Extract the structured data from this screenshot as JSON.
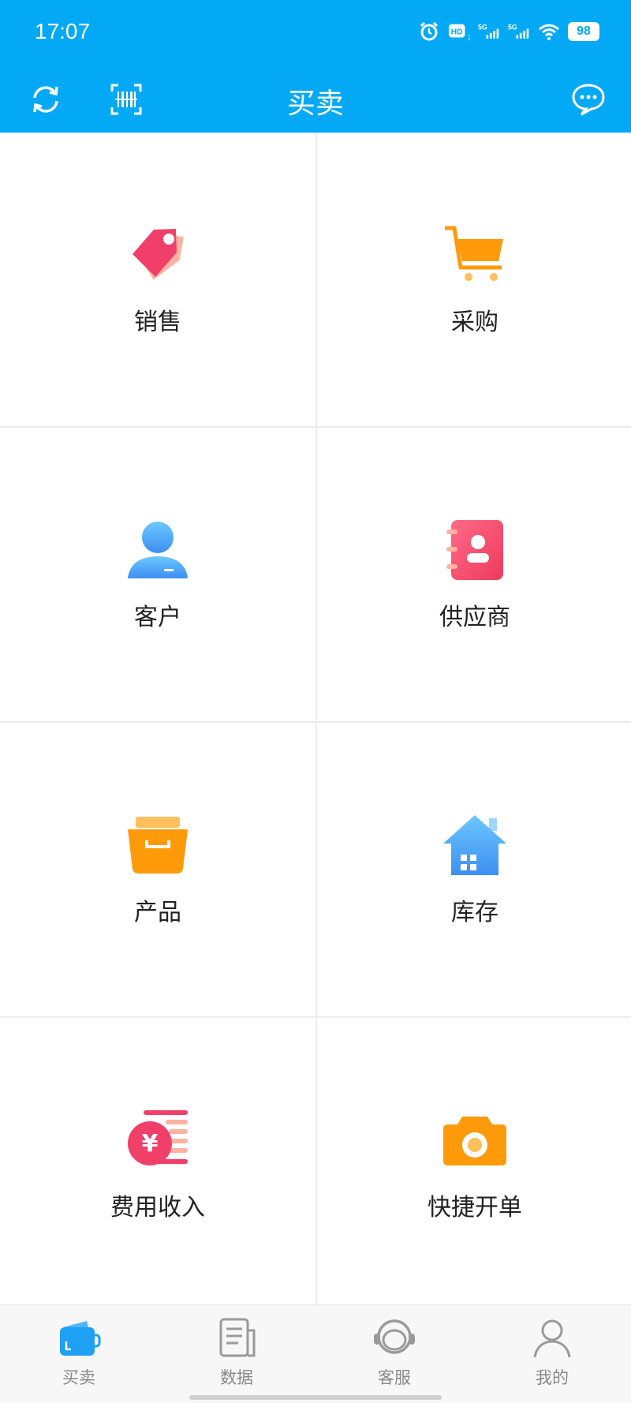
{
  "status_bar": {
    "time": "17:07",
    "battery": "98",
    "icons": [
      "alarm-icon",
      "hd-icon",
      "signal-5g-icon",
      "signal-5g-icon",
      "wifi-icon",
      "battery-icon"
    ]
  },
  "app_bar": {
    "title": "买卖",
    "left_icons": [
      "refresh-icon",
      "barcode-scan-icon"
    ],
    "right_icon": "message-icon"
  },
  "tiles": [
    {
      "label": "销售",
      "icon": "price-tag-icon",
      "color": "#f0406a"
    },
    {
      "label": "采购",
      "icon": "shopping-cart-icon",
      "color": "#ff9a0b"
    },
    {
      "label": "客户",
      "icon": "customer-icon",
      "color": "#3f9cf5"
    },
    {
      "label": "供应商",
      "icon": "contact-book-icon",
      "color": "#f0406a"
    },
    {
      "label": "产品",
      "icon": "product-box-icon",
      "color": "#ff9a0b"
    },
    {
      "label": "库存",
      "icon": "warehouse-house-icon",
      "color": "#3f9cf5"
    },
    {
      "label": "费用收入",
      "icon": "yuan-coin-icon",
      "color": "#f0406a"
    },
    {
      "label": "快捷开单",
      "icon": "camera-icon",
      "color": "#ff9a0b"
    }
  ],
  "tabs": [
    {
      "label": "买卖",
      "icon": "wallet-icon",
      "active": true
    },
    {
      "label": "数据",
      "icon": "document-icon",
      "active": false
    },
    {
      "label": "客服",
      "icon": "headset-icon",
      "active": false
    },
    {
      "label": "我的",
      "icon": "profile-icon",
      "active": false
    }
  ],
  "colors": {
    "primary": "#03a9f4",
    "tab_inactive": "#9a9a9a"
  }
}
